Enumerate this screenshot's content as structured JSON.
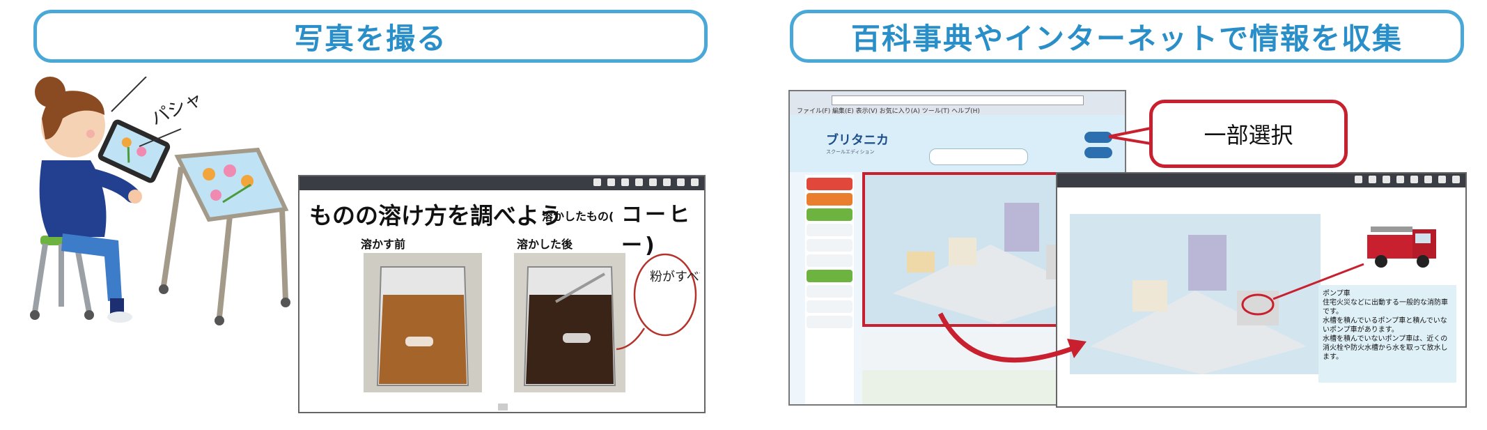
{
  "banners": {
    "left": "写真を撮る",
    "right": "百科事典やインターネットで情報を収集"
  },
  "illustration": {
    "sound_effect": "パシャ"
  },
  "whiteboard": {
    "title": "ものの溶け方を調べよう",
    "subject_label": "溶かしたもの(",
    "subject_handwritten": "コーヒー)",
    "before_label": "溶かす前",
    "after_label": "溶かした後",
    "handwritten_note": "粉がすべて溶けた"
  },
  "browser": {
    "menu": "ファイル(F) 編集(E) 表示(V) お気に入り(A) ツール(T) ヘルプ(H)",
    "logo": "ブリタニカ",
    "logo_sub": "スクールエディション"
  },
  "callout": {
    "label": "一部選択"
  },
  "whiteboard2": {
    "note": "ポンプ車\n住宅火災などに出動する一般的な消防車です。\n水槽を積んでいるポンプ車と積んでいないポンプ車があります。\n水槽を積んでいないポンプ車は、近くの消火栓や防火水槽から水を取って放水します。"
  },
  "colors": {
    "banner_border": "#4aa8d8",
    "banner_text": "#2a8fc8",
    "selection_red": "#c8202f"
  }
}
